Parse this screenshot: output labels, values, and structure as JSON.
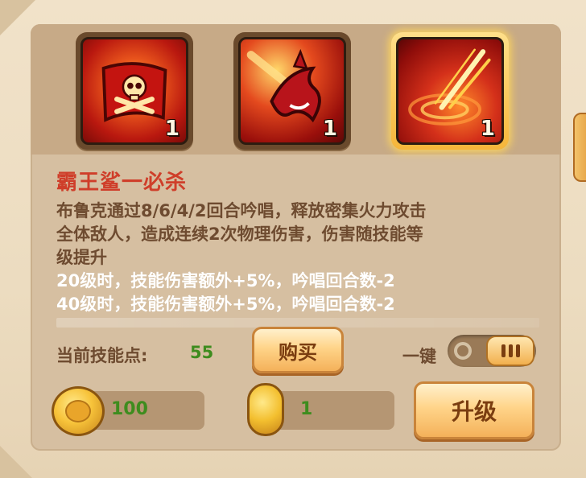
{
  "skills": [
    {
      "icon": "skull-flag-icon",
      "level": "1",
      "selected": false
    },
    {
      "icon": "shark-icon",
      "level": "1",
      "selected": false
    },
    {
      "icon": "strike-icon",
      "level": "1",
      "selected": true
    }
  ],
  "skill_detail": {
    "name": "霸王鲨一必杀",
    "description_lines": [
      "布鲁克通过8/6/4/2回合吟唱，释放密集火力攻击",
      "全体敌人，造成连续2次物理伤害，伤害随技能等",
      "级提升"
    ],
    "bonuses": [
      "20级时，技能伤害额外+5%，吟唱回合数-2",
      "40级时，技能伤害额外+5%，吟唱回合数-2"
    ]
  },
  "skill_points": {
    "label": "当前技能点:",
    "value": "55"
  },
  "buy_button": "购买",
  "one_key": {
    "label": "一键",
    "enabled": true
  },
  "resources": {
    "coin": {
      "icon": "gold-coin-icon",
      "value": "100"
    },
    "token": {
      "icon": "skill-token-icon",
      "value": "1"
    }
  },
  "upgrade_button": "升级",
  "colors": {
    "skill_name": "#cf3e2a",
    "description": "#6e4b30",
    "bonus": "#ffffff",
    "value_green": "#3e8c1e"
  }
}
